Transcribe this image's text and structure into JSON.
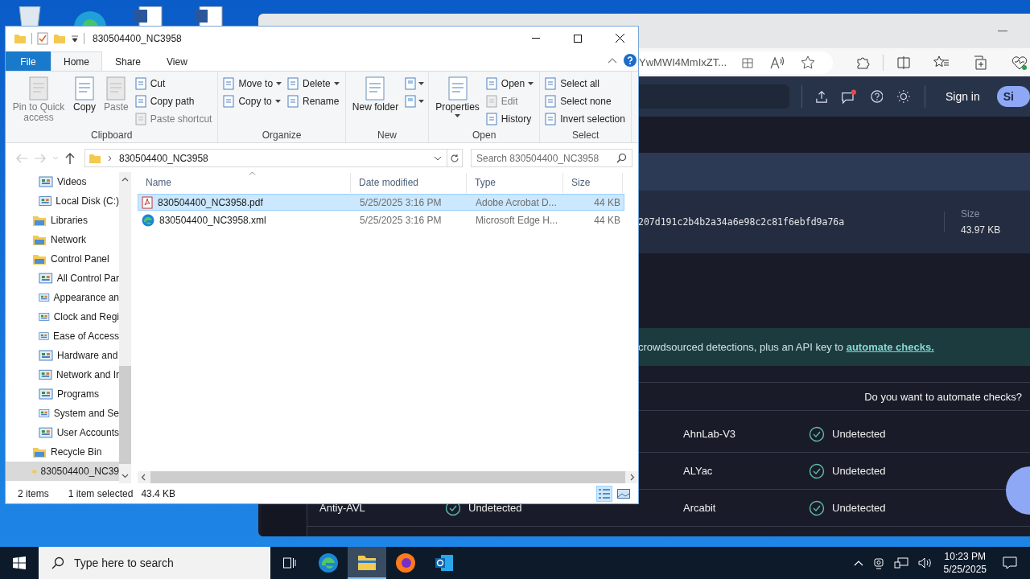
{
  "browser": {
    "url": "YwMWI4MmIxZT...",
    "site": {
      "sign_in": "Sign in",
      "signup": "Si"
    },
    "hash": "207d191c2b4b2a34a6e98c2c81f6ebfd9a76a",
    "size_label": "Size",
    "size_value": "43.97 KB",
    "banner": {
      "text": "crowdsourced detections, plus an API key to ",
      "link": "automate checks."
    },
    "automate_prompt": "Do you want to automate checks?",
    "results": [
      {
        "right": {
          "engine": "AhnLab-V3",
          "status": "Undetected",
          "detected": false
        }
      },
      {
        "right": {
          "engine": "ALYac",
          "status": "Undetected",
          "detected": false
        }
      },
      {
        "left": {
          "engine": "Antiy-AVL",
          "status": "Undetected",
          "detected": false
        },
        "right": {
          "engine": "Arcabit",
          "status": "Undetected",
          "detected": false
        }
      }
    ]
  },
  "explorer": {
    "title": "830504400_NC3958",
    "ribbon_tabs": [
      {
        "label": "File",
        "kind": "file",
        "selected": false
      },
      {
        "label": "Home",
        "kind": "tab",
        "selected": true
      },
      {
        "label": "Share",
        "kind": "tab",
        "selected": false
      },
      {
        "label": "View",
        "kind": "tab",
        "selected": false
      }
    ],
    "ribbon_groups": [
      {
        "label": "Clipboard",
        "columns": [
          [
            {
              "label": "Pin to Quick access",
              "kind": "large",
              "disabled": true,
              "menu": false
            }
          ],
          [
            {
              "label": "Copy",
              "kind": "large",
              "disabled": false,
              "menu": false
            }
          ],
          [
            {
              "label": "Paste",
              "kind": "large",
              "disabled": true,
              "menu": false
            }
          ],
          [
            {
              "label": "Cut",
              "kind": "small",
              "disabled": false,
              "menu": false
            },
            {
              "label": "Copy path",
              "kind": "small",
              "disabled": false,
              "menu": false
            },
            {
              "label": "Paste shortcut",
              "kind": "small",
              "disabled": true,
              "menu": false
            }
          ]
        ]
      },
      {
        "label": "Organize",
        "columns": [
          [
            {
              "label": "Move to",
              "kind": "small",
              "disabled": false,
              "menu": true
            },
            {
              "label": "Copy to",
              "kind": "small",
              "disabled": false,
              "menu": true
            }
          ],
          [
            {
              "label": "Delete",
              "kind": "small",
              "disabled": false,
              "menu": true
            },
            {
              "label": "Rename",
              "kind": "small",
              "disabled": false,
              "menu": false
            }
          ]
        ]
      },
      {
        "label": "New",
        "columns": [
          [
            {
              "label": "New folder",
              "kind": "large",
              "disabled": false,
              "menu": false
            }
          ],
          [
            {
              "kind": "icon",
              "menu": true
            },
            {
              "kind": "icon",
              "menu": true
            }
          ]
        ]
      },
      {
        "label": "Open",
        "columns": [
          [
            {
              "label": "Properties",
              "kind": "large",
              "disabled": false,
              "menu": true
            }
          ],
          [
            {
              "label": "Open",
              "kind": "small",
              "disabled": false,
              "menu": true
            },
            {
              "label": "Edit",
              "kind": "small",
              "disabled": true,
              "menu": false
            },
            {
              "label": "History",
              "kind": "small",
              "disabled": false,
              "menu": false
            }
          ]
        ]
      },
      {
        "label": "Select",
        "columns": [
          [
            {
              "label": "Select all",
              "kind": "small",
              "disabled": false,
              "menu": false
            },
            {
              "label": "Select none",
              "kind": "small",
              "disabled": false,
              "menu": false
            },
            {
              "label": "Invert selection",
              "kind": "small",
              "disabled": false,
              "menu": false
            }
          ]
        ]
      }
    ],
    "address": {
      "path": "830504400_NC3958"
    },
    "search": {
      "placeholder": "Search 830504400_NC3958"
    },
    "nav_tree": [
      {
        "children": [
          {
            "label": "Videos",
            "selected": false
          },
          {
            "label": "Local Disk (C:)",
            "selected": false
          }
        ]
      },
      {
        "label": "Libraries",
        "selected": false
      },
      {
        "label": "Network",
        "selected": false
      },
      {
        "label": "Control Panel",
        "selected": false,
        "children": [
          {
            "label": "All Control Par",
            "selected": false
          },
          {
            "label": "Appearance an",
            "selected": false
          },
          {
            "label": "Clock and Regi",
            "selected": false
          },
          {
            "label": "Ease of Access",
            "selected": false
          },
          {
            "label": "Hardware and",
            "selected": false
          },
          {
            "label": "Network and Ir",
            "selected": false
          },
          {
            "label": "Programs",
            "selected": false
          },
          {
            "label": "System and Se",
            "selected": false
          },
          {
            "label": "User Accounts",
            "selected": false
          }
        ]
      },
      {
        "label": "Recycle Bin",
        "selected": false
      },
      {
        "label": "830504400_NC39",
        "selected": true
      }
    ],
    "columns": [
      "Name",
      "Date modified",
      "Type",
      "Size"
    ],
    "files": [
      {
        "name": "830504400_NC3958.pdf",
        "kind": "pdf",
        "date": "5/25/2025 3:16 PM",
        "type": "Adobe Acrobat D...",
        "size": "44 KB",
        "selected": true
      },
      {
        "name": "830504400_NC3958.xml",
        "kind": "edge",
        "date": "5/25/2025 3:16 PM",
        "type": "Microsoft Edge H...",
        "size": "44 KB",
        "selected": false
      }
    ],
    "status": {
      "count": "2 items",
      "selection": "1 item selected",
      "size": "43.4 KB"
    }
  },
  "taskbar": {
    "search_placeholder": "Type here to search",
    "apps": [
      {
        "kind": "taskview",
        "active": false
      },
      {
        "kind": "edge",
        "active": false
      },
      {
        "kind": "explorer",
        "active": true
      },
      {
        "kind": "firefox",
        "active": false
      },
      {
        "kind": "outlook",
        "active": false
      }
    ],
    "time": "10:23 PM",
    "date": "5/25/2025"
  }
}
